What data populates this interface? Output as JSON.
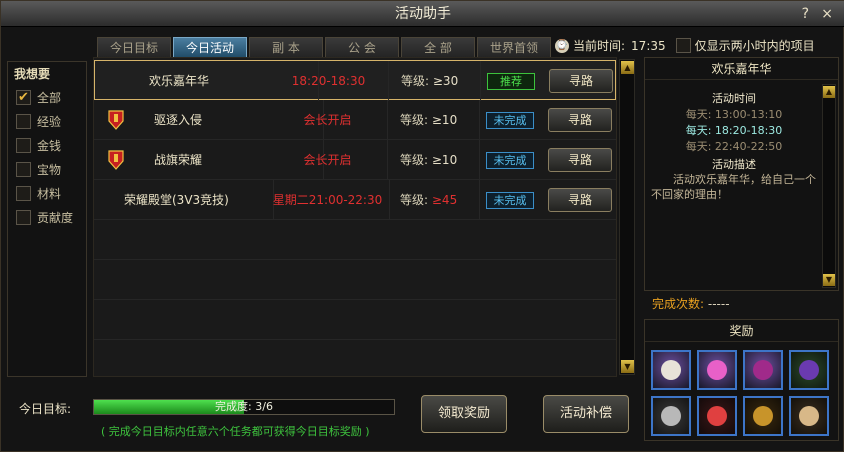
{
  "window": {
    "title": "活动助手",
    "help": "?",
    "close": "×"
  },
  "tabs": [
    {
      "label": "今日目标",
      "active": false
    },
    {
      "label": "今日活动",
      "active": true
    },
    {
      "label": "副 本",
      "active": false
    },
    {
      "label": "公 会",
      "active": false
    },
    {
      "label": "全 部",
      "active": false
    },
    {
      "label": "世界首领",
      "active": false
    }
  ],
  "clock": {
    "label": "当前时间:",
    "value": "17:35",
    "filter_label": "仅显示两小时内的项目"
  },
  "sidebar": {
    "title": "我想要",
    "items": [
      {
        "label": "全部",
        "checked": true
      },
      {
        "label": "经验",
        "checked": false
      },
      {
        "label": "金钱",
        "checked": false
      },
      {
        "label": "宝物",
        "checked": false
      },
      {
        "label": "材料",
        "checked": false
      },
      {
        "label": "贡献度",
        "checked": false
      }
    ]
  },
  "activities": [
    {
      "name": "欢乐嘉年华",
      "time": "18:20-18:30",
      "level_label": "等级:",
      "level": "≥30",
      "level_red": false,
      "status": "推荐",
      "status_type": "recommend",
      "go": "寻路",
      "has_icon": false
    },
    {
      "name": "驱逐入侵",
      "time": "会长开启",
      "level_label": "等级:",
      "level": "≥10",
      "level_red": false,
      "status": "未完成",
      "status_type": "incomplete",
      "go": "寻路",
      "has_icon": true
    },
    {
      "name": "战旗荣耀",
      "time": "会长开启",
      "level_label": "等级:",
      "level": "≥10",
      "level_red": false,
      "status": "未完成",
      "status_type": "incomplete",
      "go": "寻路",
      "has_icon": true
    },
    {
      "name": "荣耀殿堂(3V3竞技)",
      "time": "星期二21:00-22:30",
      "level_label": "等级:",
      "level": "≥45",
      "level_red": true,
      "status": "未完成",
      "status_type": "incomplete",
      "go": "寻路",
      "has_icon": false
    }
  ],
  "detail": {
    "title": "欢乐嘉年华",
    "time_heading": "活动时间",
    "times": [
      {
        "text": "每天: 13:00-13:10",
        "current": false
      },
      {
        "text": "每天: 18:20-18:30",
        "current": true
      },
      {
        "text": "每天: 22:40-22:50",
        "current": false
      }
    ],
    "desc_heading": "活动描述",
    "desc": "活动欢乐嘉年华，给自己一个不回家的理由！"
  },
  "completion": {
    "label": "完成次数:",
    "value": "-----"
  },
  "reward": {
    "title": "奖励"
  },
  "footer": {
    "goal_label": "今日目标:",
    "progress_label": "完成度: 3/6",
    "progress_fraction": 0.5,
    "hint": "( 完成今日目标内任意六个任务都可获得今日目标奖励 )",
    "claim_button": "领取奖励",
    "compensate_button": "活动补偿"
  }
}
